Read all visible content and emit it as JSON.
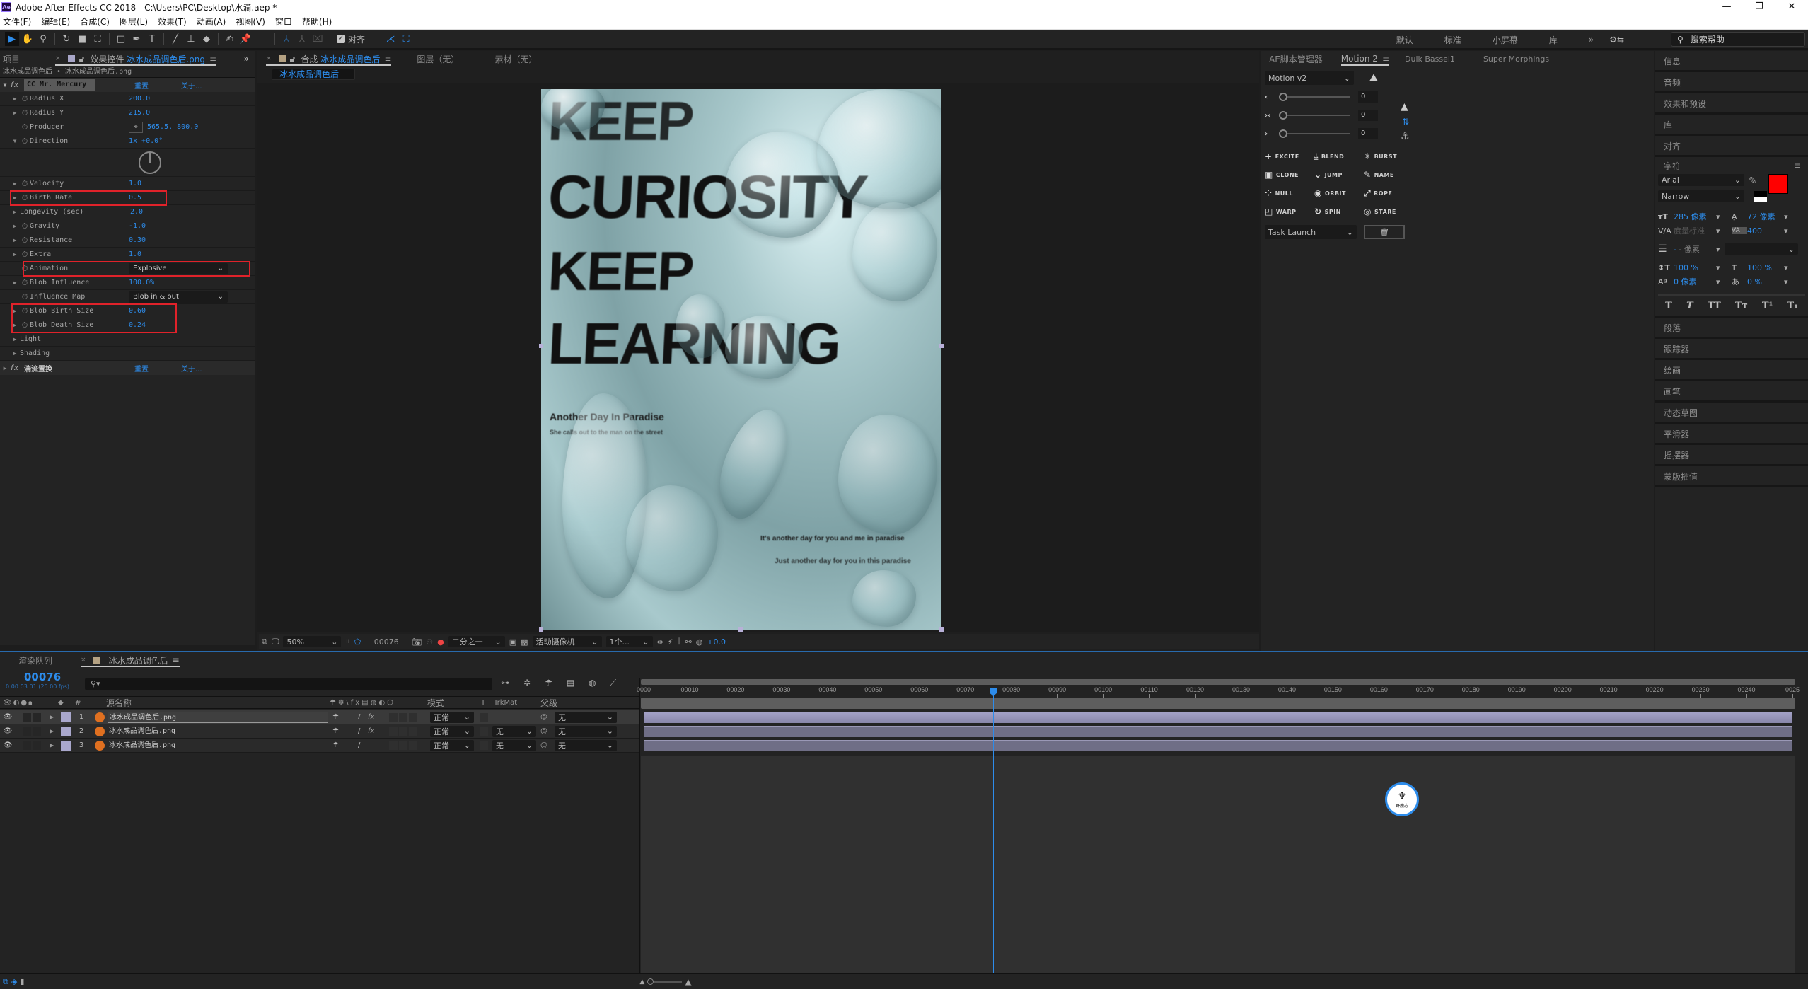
{
  "window": {
    "title": "Adobe After Effects CC 2018 - C:\\Users\\PC\\Desktop\\水滴.aep *",
    "logo": "Ae",
    "min": "—",
    "max": "❐",
    "close": "✕"
  },
  "menu": [
    "文件(F)",
    "编辑(E)",
    "合成(C)",
    "图层(L)",
    "效果(T)",
    "动画(A)",
    "视图(V)",
    "窗口",
    "帮助(H)"
  ],
  "toolbar": {
    "snap_label": "对齐",
    "workspaces": [
      "默认",
      "标准",
      "小屏幕",
      "库"
    ],
    "more": "»",
    "help_search_placeholder": "搜索帮助"
  },
  "left_panel": {
    "tab_project": "项目",
    "tab_effects_prefix": "效果控件",
    "tab_effects_name": "冰水成品调色后.png",
    "more": "»",
    "subtitle": "冰水成品调色后 • 冰水成品调色后.png",
    "effects": [
      {
        "name": "CC Mr. Mercury",
        "reset": "重置",
        "about": "关于...",
        "params": [
          {
            "name": "Radius X",
            "value": "200.0",
            "twirl": true
          },
          {
            "name": "Radius Y",
            "value": "215.0",
            "twirl": true
          },
          {
            "name": "Producer",
            "value": "565.5, 800.0",
            "twirl": false,
            "point": true
          },
          {
            "name": "Direction",
            "value": "1x +0.0°",
            "twirl": true,
            "open": true
          },
          {
            "name": "Velocity",
            "value": "1.0",
            "twirl": true
          },
          {
            "name": "Birth Rate",
            "value": "0.5",
            "twirl": true,
            "highlight": true
          },
          {
            "name": "Longevity (sec)",
            "value": "2.0",
            "twirl": true,
            "nostopwatch": true
          },
          {
            "name": "Gravity",
            "value": "-1.0",
            "twirl": true
          },
          {
            "name": "Resistance",
            "value": "0.30",
            "twirl": true
          },
          {
            "name": "Extra",
            "value": "1.0",
            "twirl": true
          },
          {
            "name": "Animation",
            "value": "Explosive",
            "dropdown": true,
            "highlight": true
          },
          {
            "name": "Blob Influence",
            "value": "100.0%",
            "twirl": true
          },
          {
            "name": "Influence Map",
            "value": "Blob in & out",
            "dropdown": true
          },
          {
            "name": "Blob Birth Size",
            "value": "0.60",
            "twirl": true,
            "highlight": true
          },
          {
            "name": "Blob Death Size",
            "value": "0.24",
            "twirl": true,
            "highlight": true
          },
          {
            "name": "Light",
            "group": true
          },
          {
            "name": "Shading",
            "group": true
          }
        ]
      },
      {
        "name": "湍流置换",
        "reset": "重置",
        "about": "关于..."
      }
    ]
  },
  "comp_panel": {
    "tab_prefix": "合成",
    "tab_name": "冰水成品调色后",
    "tab_layer": "图层（无）",
    "tab_footage": "素材（无）",
    "breadcrumb": "冰水成品调色后",
    "poster": {
      "lines": [
        "KEEP",
        "CURIOSITY",
        "KEEP",
        "LEARNING"
      ],
      "small": [
        "Another Day In Paradise",
        "She calls out to the man on the street",
        "It's another day for you and me in paradise",
        "Just another day for you in this paradise"
      ]
    },
    "footer": {
      "zoom": "50%",
      "frame": "00076",
      "resolution": "二分之一",
      "camera": "活动摄像机",
      "views": "1个...",
      "exposure": "+0.0"
    }
  },
  "motion_panel": {
    "tabs": [
      "AE脚本管理器",
      "Motion 2",
      "Duik Bassel1",
      "Super Morphings"
    ],
    "active_tab": 1,
    "preset": "Motion v2",
    "sliders": [
      {
        "icon": "‹",
        "value": "0"
      },
      {
        "icon": "›‹",
        "value": "0"
      },
      {
        "icon": "›",
        "value": "0"
      }
    ],
    "buttons": [
      {
        "icon": "+",
        "label": "EXCITE"
      },
      {
        "icon": "⤓",
        "label": "BLEND"
      },
      {
        "icon": "✳",
        "label": "BURST"
      },
      {
        "icon": "▣",
        "label": "CLONE"
      },
      {
        "icon": "⌄",
        "label": "JUMP"
      },
      {
        "icon": "✎",
        "label": "NAME"
      },
      {
        "icon": "⁘",
        "label": "NULL"
      },
      {
        "icon": "◉",
        "label": "ORBIT"
      },
      {
        "icon": "⤢",
        "label": "ROPE"
      },
      {
        "icon": "◰",
        "label": "WARP"
      },
      {
        "icon": "↻",
        "label": "SPIN"
      },
      {
        "icon": "◎",
        "label": "STARE"
      }
    ],
    "task": "Task Launch"
  },
  "right_panel": {
    "items_top": [
      "信息",
      "音频",
      "效果和预设",
      "库",
      "对齐"
    ],
    "character": {
      "title": "字符",
      "font": "Arial",
      "style": "Narrow",
      "fill_color": "#ff0000",
      "size": "285 像素",
      "leading": "72 像素",
      "kerning": "度量标准",
      "tracking": "400",
      "stroke": "- 像素",
      "vscale": "100 %",
      "hscale": "100 %",
      "baseline": "0 像素",
      "tsume": "0 %",
      "styles": [
        "T",
        "T",
        "TT",
        "Tт",
        "T¹",
        "T₁"
      ]
    },
    "items_bottom": [
      "段落",
      "跟踪器",
      "绘画",
      "画笔",
      "动态草图",
      "平滑器",
      "摇摆器",
      "蒙版插值"
    ]
  },
  "timeline": {
    "tab_render": "渲染队列",
    "tab_comp": "冰水成品调色后",
    "timecode": "00076",
    "timecode_sub": "0:00:03:01 (25.00 fps)",
    "search_placeholder": "",
    "col_num": "#",
    "col_source": "源名称",
    "col_mode": "模式",
    "col_t": "T",
    "col_trkmat": "TrkMat",
    "col_parent": "父级",
    "layers": [
      {
        "num": "1",
        "name": "冰水成品调色后.png",
        "mode": "正常",
        "trkmat": "",
        "parent": "无",
        "fx": true,
        "selected": true
      },
      {
        "num": "2",
        "name": "冰水成品调色后.png",
        "mode": "正常",
        "trkmat": "无",
        "parent": "无",
        "fx": true
      },
      {
        "num": "3",
        "name": "冰水成品调色后.png",
        "mode": "正常",
        "trkmat": "无",
        "parent": "无",
        "fx": false
      }
    ],
    "ruler": [
      "0000",
      "00010",
      "00020",
      "00030",
      "00040",
      "00050",
      "00060",
      "00070",
      "00080",
      "00090",
      "00100",
      "00110",
      "00120",
      "00130",
      "00140",
      "00150",
      "00160",
      "00170",
      "00180",
      "00190",
      "00200",
      "00210",
      "00220",
      "00230",
      "00240",
      "0025"
    ],
    "current_frame": 76,
    "total_frames": 251,
    "watermark": "野鹿志"
  }
}
